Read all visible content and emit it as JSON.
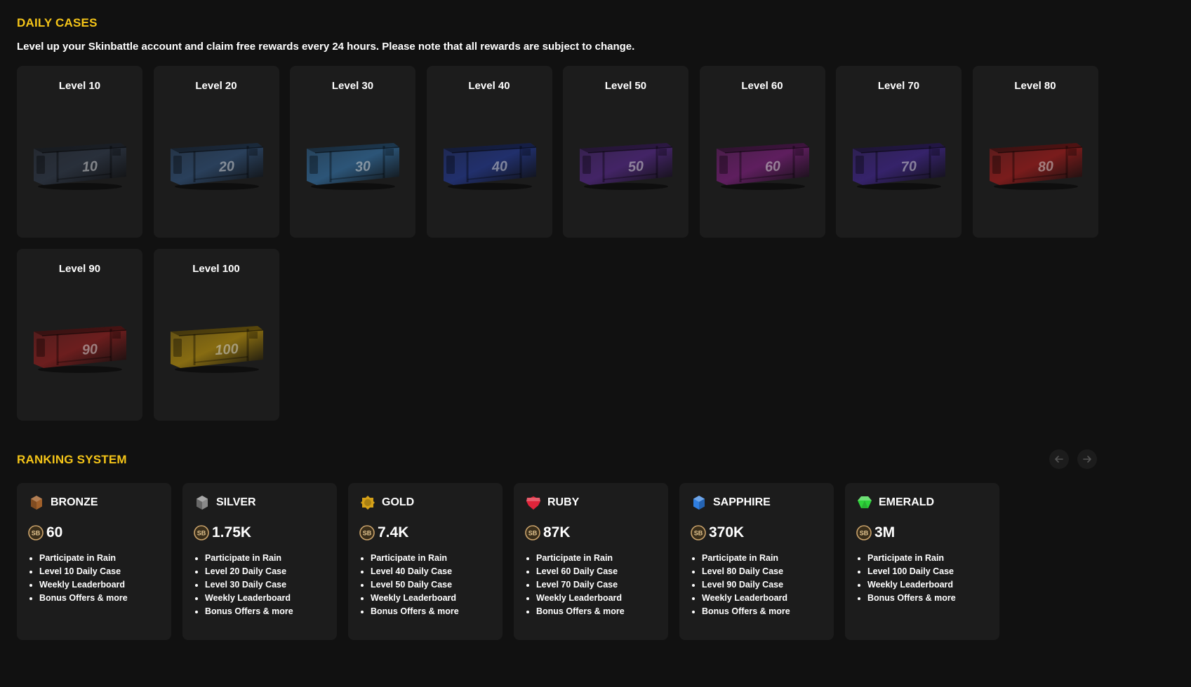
{
  "daily": {
    "title": "DAILY CASES",
    "description": "Level up your Skinbattle account and claim free rewards every 24 hours. Please note that all rewards are subject to change.",
    "cases": [
      {
        "label": "Level 10",
        "number": "10",
        "color": "#2b3340"
      },
      {
        "label": "Level 20",
        "number": "20",
        "color": "#2c4666"
      },
      {
        "label": "Level 30",
        "number": "30",
        "color": "#2f5f88"
      },
      {
        "label": "Level 40",
        "number": "40",
        "color": "#22337a"
      },
      {
        "label": "Level 50",
        "number": "50",
        "color": "#4a2673"
      },
      {
        "label": "Level 60",
        "number": "60",
        "color": "#6a1f6a"
      },
      {
        "label": "Level 70",
        "number": "70",
        "color": "#3a2478"
      },
      {
        "label": "Level 80",
        "number": "80",
        "color": "#8a1c1c"
      },
      {
        "label": "Level 90",
        "number": "90",
        "color": "#7a1e1e"
      },
      {
        "label": "Level 100",
        "number": "100",
        "color": "#9a7a10"
      }
    ]
  },
  "ranking": {
    "title": "RANKING SYSTEM",
    "nav": {
      "prev_icon": "arrow-left-icon",
      "next_icon": "arrow-right-icon"
    },
    "coin_icon": "sb-coin-icon",
    "ranks": [
      {
        "name": "BRONZE",
        "value": "60",
        "icon": "bronze-gem-icon",
        "color": "#a0602a",
        "perks": [
          "Participate in Rain",
          "Level 10 Daily Case",
          "Weekly Leaderboard",
          "Bonus Offers & more"
        ]
      },
      {
        "name": "SILVER",
        "value": "1.75K",
        "icon": "silver-gem-icon",
        "color": "#8a8a8a",
        "perks": [
          "Participate in Rain",
          "Level 20 Daily Case",
          "Level 30 Daily Case",
          "Weekly Leaderboard",
          "Bonus Offers & more"
        ]
      },
      {
        "name": "GOLD",
        "value": "7.4K",
        "icon": "gold-gem-icon",
        "color": "#d4a018",
        "perks": [
          "Participate in Rain",
          "Level 40 Daily Case",
          "Level 50 Daily Case",
          "Weekly Leaderboard",
          "Bonus Offers & more"
        ]
      },
      {
        "name": "RUBY",
        "value": "87K",
        "icon": "ruby-gem-icon",
        "color": "#e0243a",
        "perks": [
          "Participate in Rain",
          "Level 60 Daily Case",
          "Level 70 Daily Case",
          "Weekly Leaderboard",
          "Bonus Offers & more"
        ]
      },
      {
        "name": "SAPPHIRE",
        "value": "370K",
        "icon": "sapphire-gem-icon",
        "color": "#2f7ee0",
        "perks": [
          "Participate in Rain",
          "Level 80 Daily Case",
          "Level 90 Daily Case",
          "Weekly Leaderboard",
          "Bonus Offers & more"
        ]
      },
      {
        "name": "EMERALD",
        "value": "3M",
        "icon": "emerald-gem-icon",
        "color": "#2ed33a",
        "perks": [
          "Participate in Rain",
          "Level 100 Daily Case",
          "Weekly Leaderboard",
          "Bonus Offers & more"
        ]
      }
    ]
  },
  "colors": {
    "accent": "#f5c518",
    "background": "#111111",
    "card": "#1c1c1c"
  }
}
